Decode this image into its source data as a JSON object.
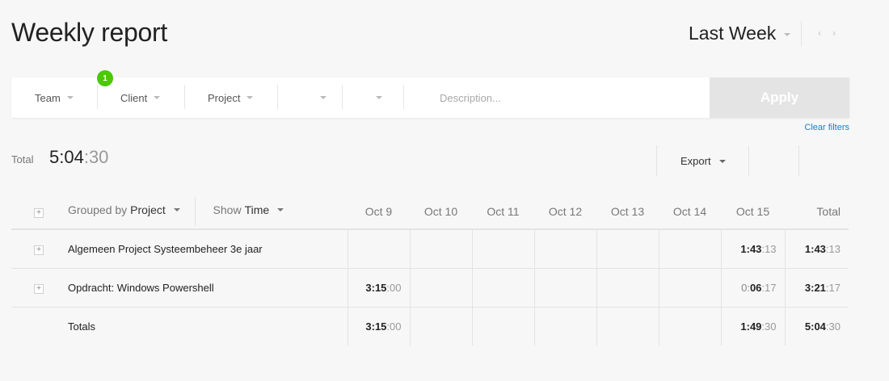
{
  "header": {
    "title": "Weekly report",
    "period": "Last Week"
  },
  "filters": {
    "team": "Team",
    "team_badge": "1",
    "client": "Client",
    "project": "Project",
    "description_placeholder": "Description...",
    "apply": "Apply",
    "clear": "Clear filters"
  },
  "summary": {
    "total_label": "Total",
    "total_main": "5:04",
    "total_sec": ":30",
    "export": "Export"
  },
  "table": {
    "grouped_by_prefix": "Grouped by",
    "grouped_by_value": "Project",
    "show_prefix": "Show",
    "show_value": "Time",
    "columns": [
      "Oct 9",
      "Oct 10",
      "Oct 11",
      "Oct 12",
      "Oct 13",
      "Oct 14",
      "Oct 15",
      "Total"
    ],
    "rows": [
      {
        "name": "Algemeen Project Systeembeheer 3e jaar",
        "oct15_h": "1:43",
        "oct15_s": ":13",
        "total_h": "1:43",
        "total_s": ":13"
      },
      {
        "name": "Opdracht: Windows Powershell",
        "oct9_h": "3:15",
        "oct9_s": ":00",
        "oct15_h0": "0:",
        "oct15_h": "06",
        "oct15_s": ":17",
        "total_h": "3:21",
        "total_s": ":17"
      }
    ],
    "totals": {
      "label": "Totals",
      "oct9_h": "3:15",
      "oct9_s": ":00",
      "oct15_h": "1:49",
      "oct15_s": ":30",
      "total_h": "5:04",
      "total_s": ":30"
    }
  },
  "colors": {
    "badge": "#4bc800",
    "link": "#1a82c8",
    "apply_bg": "#e4e4e4"
  }
}
